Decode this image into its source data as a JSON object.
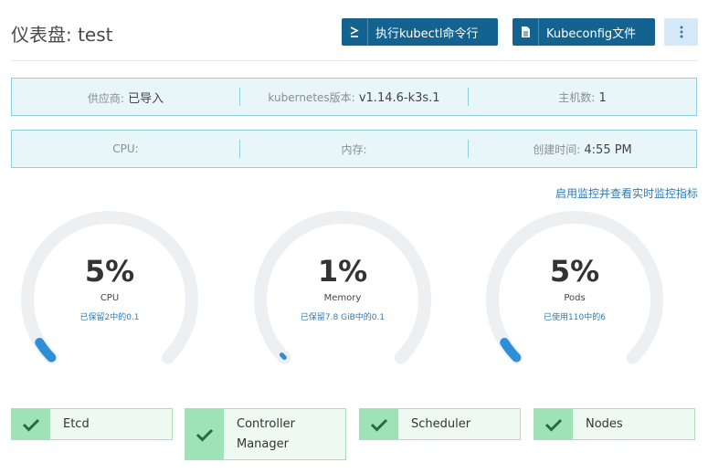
{
  "header": {
    "title": "仪表盘: test",
    "kubectl_button": "执行kubectl命令行",
    "kubeconfig_button": "Kubeconfig文件"
  },
  "info_row1": {
    "provider_label": "供应商:",
    "provider_value": "已导入",
    "k8s_label": "kubernetes版本:",
    "k8s_value": "v1.14.6-k3s.1",
    "hosts_label": "主机数:",
    "hosts_value": "1"
  },
  "info_row2": {
    "cpu_label": "CPU:",
    "cpu_value": "",
    "memory_label": "内存:",
    "memory_value": "",
    "created_label": "创建时间:",
    "created_value": "4:55 PM"
  },
  "monitor_link": "启用监控并查看实时监控指标",
  "gauges": [
    {
      "percent": "5%",
      "fraction": 0.05,
      "name": "CPU",
      "detail": "已保留2中的0.1"
    },
    {
      "percent": "1%",
      "fraction": 0.01,
      "name": "Memory",
      "detail": "已保留7.8 GiB中的0.1"
    },
    {
      "percent": "5%",
      "fraction": 0.05,
      "name": "Pods",
      "detail": "已使用110中的6"
    }
  ],
  "components": [
    {
      "name": "Etcd",
      "status": "check-icon"
    },
    {
      "name": "Controller Manager",
      "status": "check-icon"
    },
    {
      "name": "Scheduler",
      "status": "check-icon"
    },
    {
      "name": "Nodes",
      "status": "check-icon"
    }
  ],
  "colors": {
    "primary": "#14628f",
    "gauge_fill": "#2f8fd6",
    "gauge_track": "#edf0f2",
    "status_ok": "#9ee2b6"
  }
}
